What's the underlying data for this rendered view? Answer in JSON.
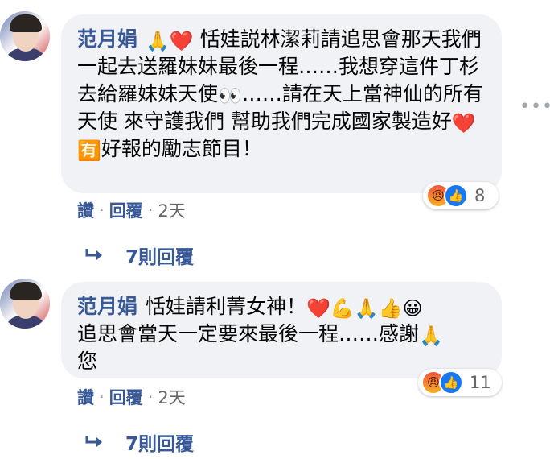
{
  "comments": [
    {
      "author": "范月娟",
      "emoji_lead": "🙏❤️",
      "text_parts": [
        "恬娃説林潔莉請追思會那天我們一起去送羅妹妹最後一程……我想穿這件丁杉去給羅妹妹天使",
        "👀",
        "……請在天上當神仙的所有天使 來守護我們 幫助我們完成國家製造好",
        "❤️",
        "🈶",
        "好報的勵志節目！"
      ],
      "reactions": {
        "icons": [
          "angry-reaction",
          "like-reaction"
        ],
        "count": "8"
      },
      "actions": {
        "like": "讚",
        "reply": "回覆",
        "time": "2天"
      },
      "replies_label": "7則回覆"
    },
    {
      "author": "范月娟",
      "text_parts": [
        "恬娃請利菁女神！",
        "❤️💪🙏👍😀",
        "追思會當天一定要來最後一程……感謝",
        "🙏",
        "您"
      ],
      "reactions": {
        "icons": [
          "angry-reaction",
          "like-reaction"
        ],
        "count": "11"
      },
      "actions": {
        "like": "讚",
        "reply": "回覆",
        "time": "2天"
      },
      "replies_label": "7則回覆"
    }
  ],
  "more_icon": "ellipsis-icon",
  "colors": {
    "link": "#385898",
    "bubble": "#f0f2f5",
    "like": "#1877f2"
  }
}
